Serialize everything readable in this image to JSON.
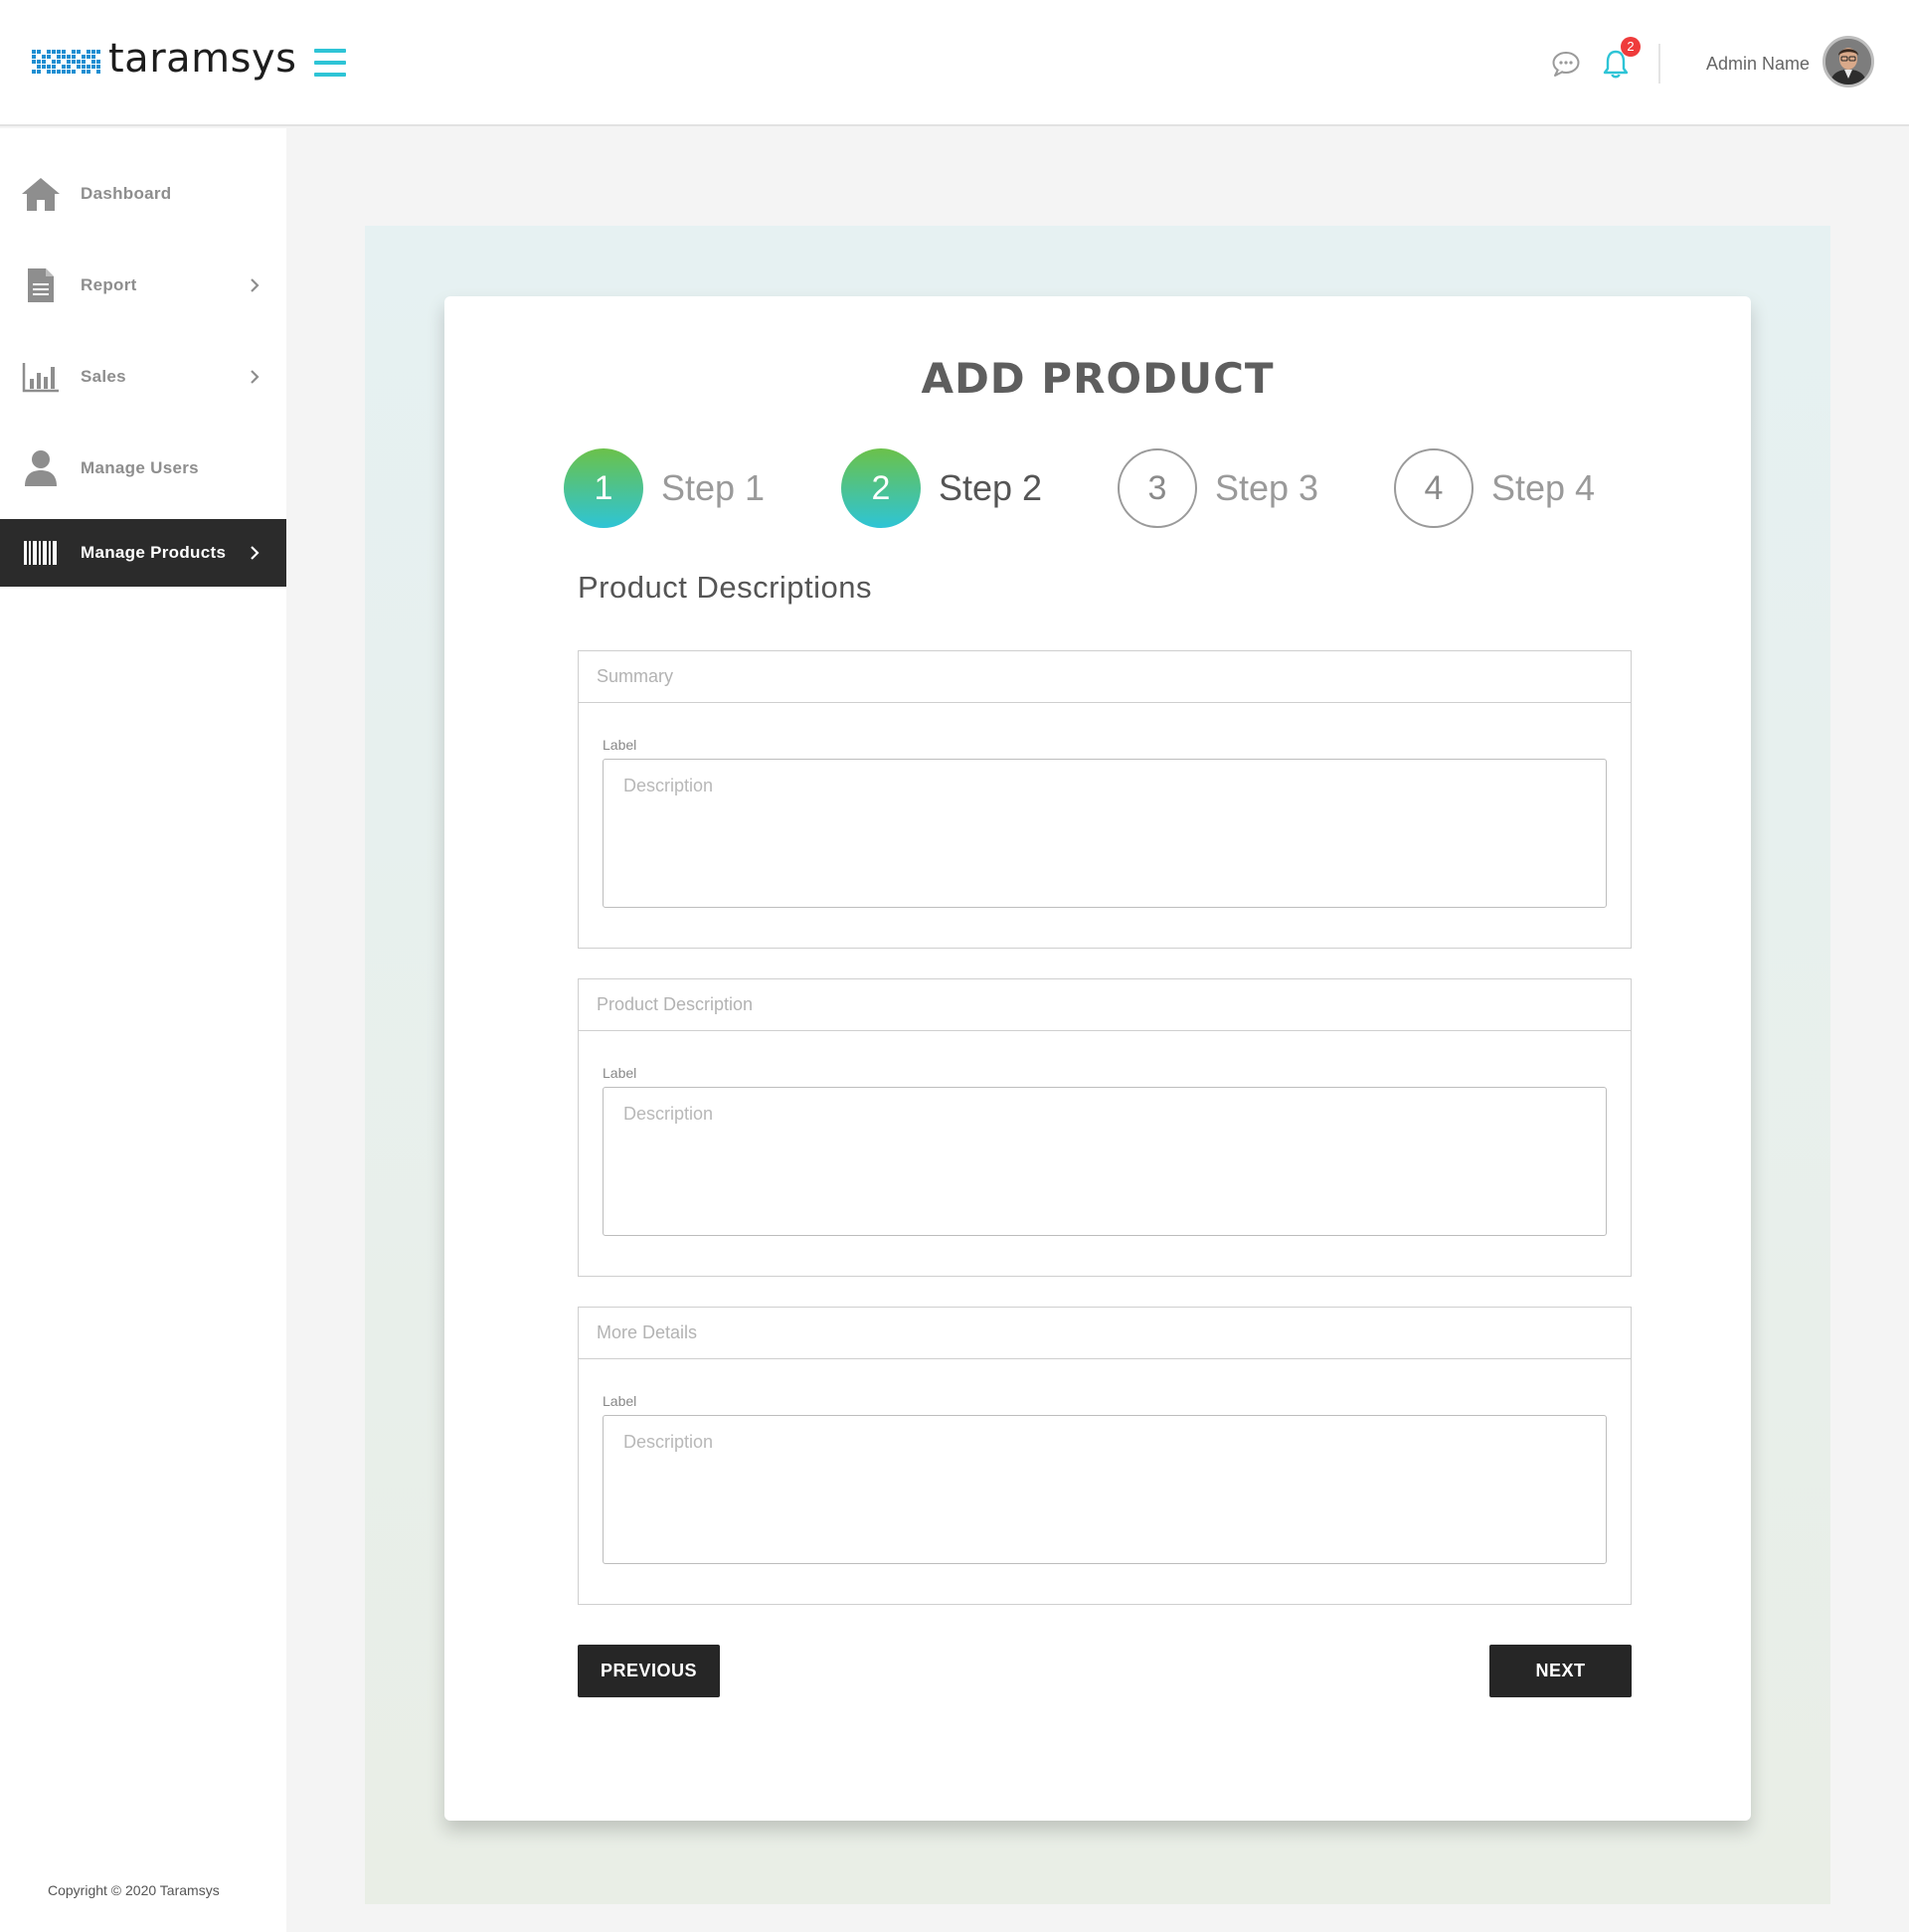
{
  "brand": {
    "name": "taramsys",
    "accent": "#2ec4d6",
    "logo_color": "#1a8fd2"
  },
  "header": {
    "notification_count": "2",
    "admin_name": "Admin Name",
    "icons": {
      "menu": "hamburger-icon",
      "chat": "chat-icon",
      "bell": "bell-icon",
      "avatar": "avatar"
    }
  },
  "sidebar": {
    "items": [
      {
        "label": "Dashboard",
        "icon": "home-icon",
        "has_submenu": false,
        "active": false
      },
      {
        "label": "Report",
        "icon": "document-icon",
        "has_submenu": true,
        "active": false
      },
      {
        "label": "Sales",
        "icon": "bar-chart-icon",
        "has_submenu": true,
        "active": false
      },
      {
        "label": "Manage Users",
        "icon": "user-icon",
        "has_submenu": false,
        "active": false
      },
      {
        "label": "Manage Products",
        "icon": "barcode-icon",
        "has_submenu": true,
        "active": true
      }
    ],
    "copyright": "Copyright © 2020 Taramsys"
  },
  "main": {
    "title": "ADD PRODUCT",
    "steps": [
      {
        "number": "1",
        "label": "Step 1",
        "state": "completed"
      },
      {
        "number": "2",
        "label": "Step 2",
        "state": "current"
      },
      {
        "number": "3",
        "label": "Step 3",
        "state": "upcoming"
      },
      {
        "number": "4",
        "label": "Step 4",
        "state": "upcoming"
      }
    ],
    "section_heading": "Product Descriptions",
    "fields": [
      {
        "title_placeholder": "Summary",
        "label": "Label",
        "description_placeholder": "Description"
      },
      {
        "title_placeholder": "Product Description",
        "label": "Label",
        "description_placeholder": "Description"
      },
      {
        "title_placeholder": "More Details",
        "label": "Label",
        "description_placeholder": "Description"
      }
    ],
    "buttons": {
      "previous": "PREVIOUS",
      "next": "NEXT"
    }
  }
}
